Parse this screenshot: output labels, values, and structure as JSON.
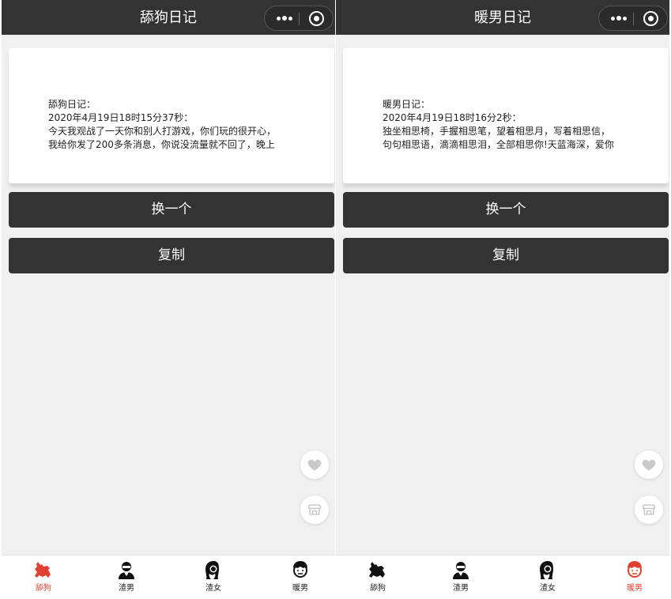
{
  "screens": [
    {
      "title": "舔狗日记",
      "card": {
        "heading": "舔狗日记：",
        "date": "2020年4月19日18时15分37秒：",
        "line1": "今天我观战了一天你和别人打游戏，你们玩的很开心，",
        "line2": "我给你发了200多条消息，你说没流量就不回了，晚上"
      },
      "refresh_label": "换一个",
      "copy_label": "复制",
      "active_tab": 0
    },
    {
      "title": "暖男日记",
      "card": {
        "heading": "暖男日记：",
        "date": "2020年4月19日18时16分2秒：",
        "line1": "独坐相思椅，手握相思笔，望着相思月，写着相思信，",
        "line2": "句句相思语，滴滴相思泪，全部相思你!天蓝海深，爱你"
      },
      "refresh_label": "换一个",
      "copy_label": "复制",
      "active_tab": 3
    }
  ],
  "tabs": [
    {
      "label": "舔狗",
      "icon": "dog-icon"
    },
    {
      "label": "渣男",
      "icon": "bad-boy-icon"
    },
    {
      "label": "渣女",
      "icon": "bad-girl-icon"
    },
    {
      "label": "暖男",
      "icon": "warm-boy-icon"
    }
  ],
  "colors": {
    "navbar": "#333333",
    "button": "#333333",
    "accent": "#e0402f",
    "background": "#f0f0f0"
  }
}
